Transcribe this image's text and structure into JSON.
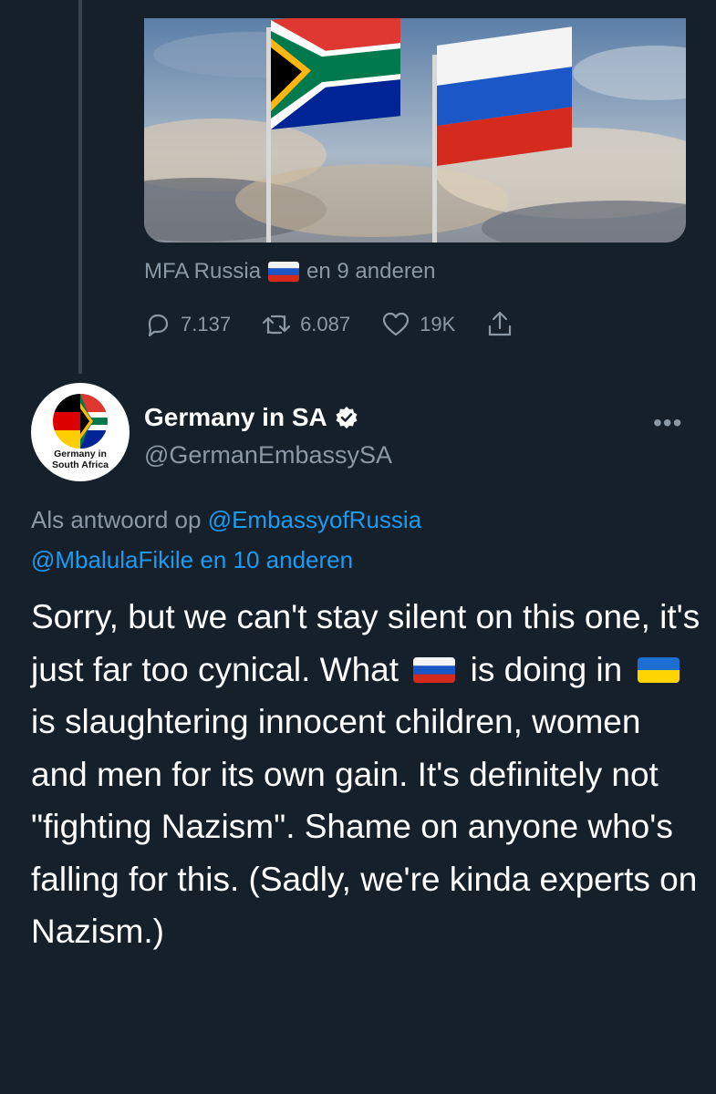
{
  "quoted_tweet": {
    "liked_by_name": "MFA Russia",
    "liked_by_rest": "en 9 anderen",
    "liked_by_flag_icon": "russia-flag-icon",
    "stats": {
      "replies": "7.137",
      "retweets": "6.087",
      "likes": "19K"
    }
  },
  "tweet": {
    "display_name": "Germany in SA",
    "handle": "@GermanEmbassySA",
    "avatar_text_line1": "Germany in",
    "avatar_text_line2": "South Africa",
    "reply_prefix": "Als antwoord op",
    "reply_user1": "@EmbassyofRussia",
    "reply_user2": "@MbalulaFikile",
    "reply_suffix": "en 10 anderen",
    "text_part1": "Sorry, but we can't stay silent on this one, it's just far too cynical. What",
    "text_part2": "is doing in",
    "text_part3": "is slaughtering innocent children, women and men for its own gain. It's definitely not \"fighting Nazism\". Shame on anyone who's falling for this. (Sadly, we're kinda experts on Nazism.)",
    "flag1_icon": "russia-flag-icon",
    "flag2_icon": "ukraine-flag-icon"
  },
  "colors": {
    "background": "#15202b",
    "secondary_text": "#8b98a5",
    "link": "#1d9bf0",
    "verified_badge": "#ffffff"
  }
}
